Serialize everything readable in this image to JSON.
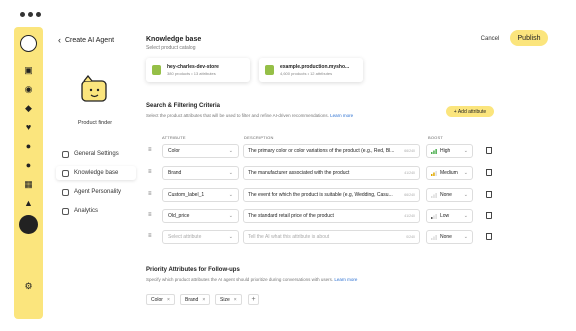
{
  "header": {
    "back_label": "Create AI Agent",
    "cancel_label": "Cancel",
    "publish_label": "Publish"
  },
  "agent": {
    "name": "Product finder"
  },
  "nav": [
    {
      "label": "General Settings"
    },
    {
      "label": "Knowledge base"
    },
    {
      "label": "Agent Personality"
    },
    {
      "label": "Analytics"
    }
  ],
  "knowledge": {
    "title": "Knowledge base",
    "subtitle": "Select product catalog",
    "stores": [
      {
        "name": "hey-charles-dev-store",
        "meta": "380 products • 13 attributes"
      },
      {
        "name": "example.production.mysho...",
        "meta": "4,600 products • 12 attributes"
      }
    ]
  },
  "search": {
    "title": "Search & Filtering Criteria",
    "subtitle": "Select the product attributes that will be used to filter and refine AI-driven recommendations.",
    "learn_more": "Learn more",
    "add_label": "+ Add attribute",
    "headers": {
      "attribute": "ATTRIBUTE",
      "description": "DESCRIPTION",
      "boost": "BOOST"
    },
    "rows": [
      {
        "attribute": "Color",
        "description": "The primary color or color variations of the product (e.g., Red, Bl...",
        "count": "66/240",
        "boost": "High"
      },
      {
        "attribute": "Brand",
        "description": "The manufacturer associated with the product",
        "count": "41/240",
        "boost": "Medium"
      },
      {
        "attribute": "Custom_label_1",
        "description": "The event for which the product is suitable (e.g, Wedding, Casu...",
        "count": "66/240",
        "boost": "None"
      },
      {
        "attribute": "Old_price",
        "description": "The standard retail price of the product",
        "count": "41/240",
        "boost": "Low"
      },
      {
        "attribute": "Select attribute",
        "description": "Tell the AI what this attribute is about",
        "count": "0/240",
        "boost": "None"
      }
    ]
  },
  "followups": {
    "title": "Priority Attributes for Follow-ups",
    "subtitle": "Specify which product attributes the AI agent should prioritize during conversations with users.",
    "learn_more": "Learn more",
    "chips": [
      "Color",
      "Brand",
      "Size"
    ]
  },
  "colors": {
    "accent": "#fbe57d",
    "shopify": "#95bf47",
    "link": "#2a6fd1"
  }
}
